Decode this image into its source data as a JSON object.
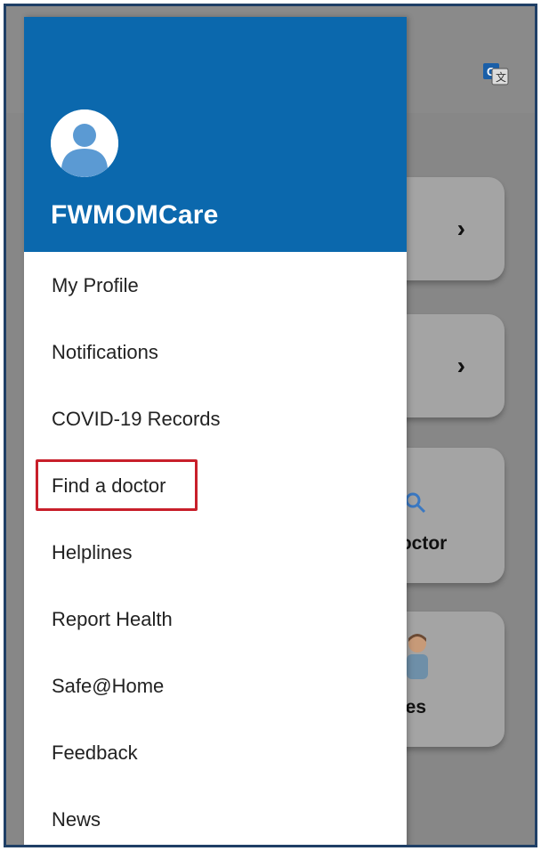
{
  "drawer": {
    "app_name": "FWMOMCare",
    "menu_items": [
      {
        "label": "My Profile"
      },
      {
        "label": "Notifications"
      },
      {
        "label": "COVID-19 Records"
      },
      {
        "label": "Find a doctor",
        "highlighted": true
      },
      {
        "label": "Helplines"
      },
      {
        "label": "Report Health"
      },
      {
        "label": "Safe@Home"
      },
      {
        "label": "Feedback"
      },
      {
        "label": "News"
      }
    ]
  },
  "background": {
    "cards": [
      {
        "text": "",
        "icon": "chevron-right-icon"
      },
      {
        "text": "",
        "icon": "chevron-right-icon"
      },
      {
        "text": "doctor",
        "icon": "search-icon"
      },
      {
        "text": "ines",
        "icon": "person-icon"
      }
    ]
  },
  "colors": {
    "header_blue": "#0b68ad",
    "highlight_red": "#c81f2a",
    "scrim_gray": "#878787"
  }
}
